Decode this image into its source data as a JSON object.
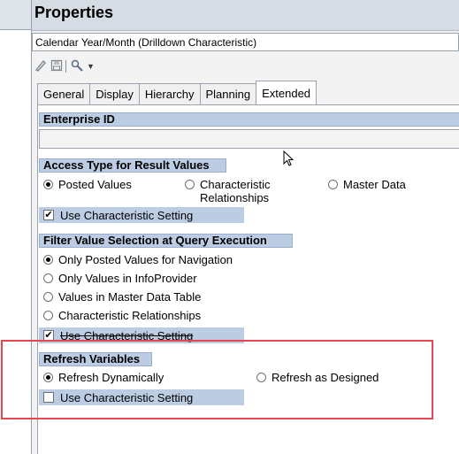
{
  "panel": {
    "title": "Properties",
    "object_name": "Calendar Year/Month (Drilldown Characteristic)"
  },
  "toolbar": {
    "icons": [
      "edit-icon",
      "save-icon",
      "tools-icon",
      "dropdown-arrow-icon"
    ]
  },
  "tabs": [
    {
      "label": "General",
      "active": false
    },
    {
      "label": "Display",
      "active": false
    },
    {
      "label": "Hierarchy",
      "active": false
    },
    {
      "label": "Planning",
      "active": false
    },
    {
      "label": "Extended",
      "active": true
    }
  ],
  "enterprise": {
    "header": "Enterprise ID",
    "value": ""
  },
  "access": {
    "header": "Access Type for Result Values",
    "options": [
      {
        "label": "Posted Values",
        "selected": true
      },
      {
        "label": "Characteristic\nRelationships",
        "selected": false
      },
      {
        "label": "Master Data",
        "selected": false
      }
    ],
    "use_char_setting": {
      "label": "Use Characteristic Setting",
      "checked": true
    }
  },
  "filter": {
    "header": "Filter Value Selection at Query Execution",
    "options": [
      {
        "label": "Only Posted Values for Navigation",
        "selected": true
      },
      {
        "label": "Only Values in InfoProvider",
        "selected": false
      },
      {
        "label": "Values in Master Data Table",
        "selected": false
      },
      {
        "label": "Characteristic Relationships",
        "selected": false
      }
    ],
    "use_char_setting": {
      "label": "Use Characteristic Setting",
      "checked": true
    }
  },
  "refresh": {
    "header": "Refresh Variables",
    "options": [
      {
        "label": "Refresh Dynamically",
        "selected": true
      },
      {
        "label": "Refresh as Designed",
        "selected": false
      }
    ],
    "use_char_setting": {
      "label": "Use Characteristic Setting",
      "checked": false
    }
  },
  "colors": {
    "section_header": "#bccde3",
    "highlight": "#e8464e",
    "title_bar": "#d6dce3"
  }
}
